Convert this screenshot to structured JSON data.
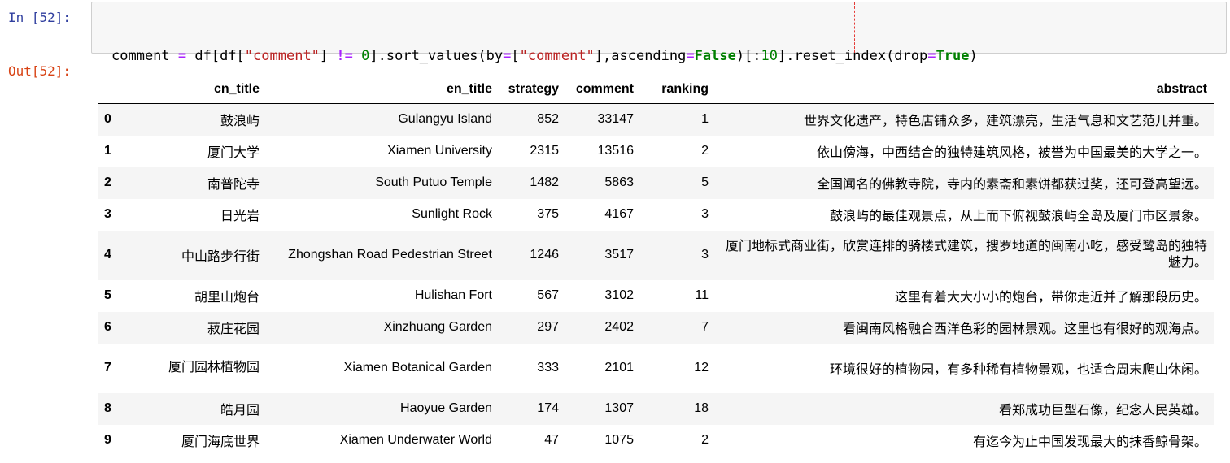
{
  "input_prompt": "In [52]:",
  "output_prompt": "Out[52]:",
  "code": {
    "line1": [
      {
        "t": "comment ",
        "c": ""
      },
      {
        "t": "=",
        "c": "op"
      },
      {
        "t": " df[df[",
        "c": ""
      },
      {
        "t": "\"comment\"",
        "c": "str"
      },
      {
        "t": "] ",
        "c": ""
      },
      {
        "t": "!=",
        "c": "op"
      },
      {
        "t": " ",
        "c": ""
      },
      {
        "t": "0",
        "c": "num"
      },
      {
        "t": "].sort_values(by",
        "c": ""
      },
      {
        "t": "=",
        "c": "op"
      },
      {
        "t": "[",
        "c": ""
      },
      {
        "t": "\"comment\"",
        "c": "str"
      },
      {
        "t": "],ascending",
        "c": ""
      },
      {
        "t": "=",
        "c": "op"
      },
      {
        "t": "False",
        "c": "kw"
      },
      {
        "t": ")[:",
        "c": ""
      },
      {
        "t": "10",
        "c": "num"
      },
      {
        "t": "].reset_index(drop",
        "c": ""
      },
      {
        "t": "=",
        "c": "op"
      },
      {
        "t": "True",
        "c": "kw"
      },
      {
        "t": ")",
        "c": ""
      }
    ],
    "line2": "comment"
  },
  "table": {
    "columns": [
      "",
      "cn_title",
      "en_title",
      "strategy",
      "comment",
      "ranking",
      "abstract"
    ],
    "rows": [
      {
        "index": "0",
        "cn_title": "鼓浪屿",
        "en_title": "Gulangyu Island",
        "strategy": "852",
        "comment": "33147",
        "ranking": "1",
        "abstract": "世界文化遗产，特色店铺众多，建筑漂亮，生活气息和文艺范儿并重。"
      },
      {
        "index": "1",
        "cn_title": "厦门大学",
        "en_title": "Xiamen University",
        "strategy": "2315",
        "comment": "13516",
        "ranking": "2",
        "abstract": "依山傍海，中西结合的独特建筑风格，被誉为中国最美的大学之一。"
      },
      {
        "index": "2",
        "cn_title": "南普陀寺",
        "en_title": "South Putuo Temple",
        "strategy": "1482",
        "comment": "5863",
        "ranking": "5",
        "abstract": "全国闻名的佛教寺院，寺内的素斋和素饼都获过奖，还可登高望远。"
      },
      {
        "index": "3",
        "cn_title": "日光岩",
        "en_title": "Sunlight Rock",
        "strategy": "375",
        "comment": "4167",
        "ranking": "3",
        "abstract": "鼓浪屿的最佳观景点，从上而下俯视鼓浪屿全岛及厦门市区景象。"
      },
      {
        "index": "4",
        "cn_title": "中山路步行街",
        "en_title": "Zhongshan Road Pedestrian Street",
        "strategy": "1246",
        "comment": "3517",
        "ranking": "3",
        "abstract": "厦门地标式商业街，欣赏连排的骑楼式建筑，搜罗地道的闽南小吃，感受鹭岛的独特魅力。"
      },
      {
        "index": "5",
        "cn_title": "胡里山炮台",
        "en_title": "Hulishan Fort",
        "strategy": "567",
        "comment": "3102",
        "ranking": "11",
        "abstract": "这里有着大大小小的炮台，带你走近并了解那段历史。"
      },
      {
        "index": "6",
        "cn_title": "菽庄花园",
        "en_title": "Xinzhuang Garden",
        "strategy": "297",
        "comment": "2402",
        "ranking": "7",
        "abstract": "看闽南风格融合西洋色彩的园林景观。这里也有很好的观海点。"
      },
      {
        "index": "7",
        "cn_title": "厦门园林植物园",
        "en_title": "Xiamen Botanical Garden",
        "strategy": "333",
        "comment": "2101",
        "ranking": "12",
        "abstract": "环境很好的植物园，有多种稀有植物景观，也适合周末爬山休闲。"
      },
      {
        "index": "8",
        "cn_title": "皓月园",
        "en_title": "Haoyue Garden",
        "strategy": "174",
        "comment": "1307",
        "ranking": "18",
        "abstract": "看郑成功巨型石像，纪念人民英雄。"
      },
      {
        "index": "9",
        "cn_title": "厦门海底世界",
        "en_title": "Xiamen Underwater World",
        "strategy": "47",
        "comment": "1075",
        "ranking": "2",
        "abstract": "有迄今为止中国发现最大的抹香鲸骨架。"
      }
    ]
  }
}
